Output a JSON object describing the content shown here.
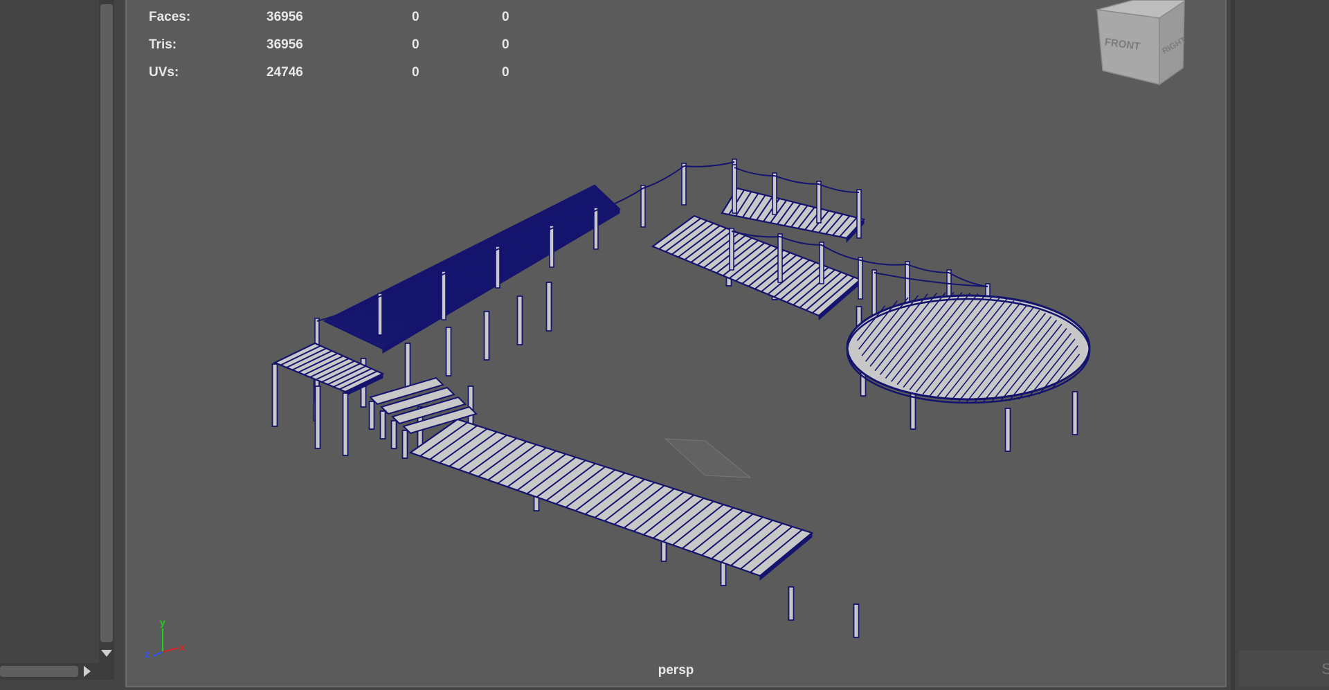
{
  "hud": {
    "rows": [
      {
        "label": "Faces:",
        "col1": "36956",
        "col2": "0",
        "col3": "0"
      },
      {
        "label": "Tris:",
        "col1": "36956",
        "col2": "0",
        "col3": "0"
      },
      {
        "label": "UVs:",
        "col1": "24746",
        "col2": "0",
        "col3": "0"
      }
    ]
  },
  "viewcube": {
    "front_label": "FRONT",
    "right_label": "RIGHT"
  },
  "axis": {
    "x": "x",
    "y": "y",
    "z": "z",
    "x_color": "#e02020",
    "y_color": "#20d020",
    "z_color": "#3050ff"
  },
  "camera": {
    "label": "persp"
  },
  "right_panel": {
    "field_text": "S"
  },
  "colors": {
    "wireframe": "#14146e",
    "plank_fill": "#c8c8c8",
    "viewport_bg": "#5b5b5b"
  }
}
